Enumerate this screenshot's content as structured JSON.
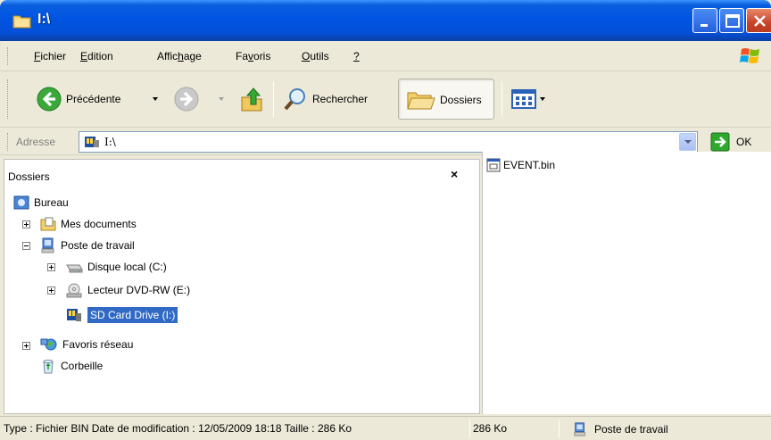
{
  "window": {
    "title": "I:\\"
  },
  "menu": {
    "items": [
      {
        "label_u": "F",
        "label_rest": "ichier"
      },
      {
        "label_u": "E",
        "label_rest": "dition"
      },
      {
        "label_pre": "Affic",
        "label_u": "h",
        "label_rest": "age"
      },
      {
        "label_pre": "Fa",
        "label_u": "v",
        "label_rest": "oris"
      },
      {
        "label_u": "O",
        "label_rest": "utils"
      },
      {
        "label_u": "?",
        "label_rest": ""
      }
    ]
  },
  "toolbar": {
    "back_label": "Précédente",
    "search_label": "Rechercher",
    "folders_label": "Dossiers"
  },
  "address": {
    "label": "Adresse",
    "value": "I:\\",
    "go_label": "OK"
  },
  "folders_pane": {
    "title": "Dossiers",
    "close_glyph": "×",
    "tree": [
      {
        "label": "Bureau"
      },
      {
        "label": "Mes documents"
      },
      {
        "label": "Poste de travail"
      },
      {
        "label": "Disque local (C:)"
      },
      {
        "label": "Lecteur DVD-RW (E:)"
      },
      {
        "label": "SD Card Drive (I:)"
      },
      {
        "label": "Favoris réseau"
      },
      {
        "label": "Corbeille"
      }
    ]
  },
  "files": [
    {
      "name": "EVENT.bin"
    }
  ],
  "status": {
    "details": "Type : Fichier BIN Date de modification : 12/05/2009 18:18 Taille : 286 Ko",
    "size": "286 Ko",
    "zone": "Poste de travail"
  }
}
